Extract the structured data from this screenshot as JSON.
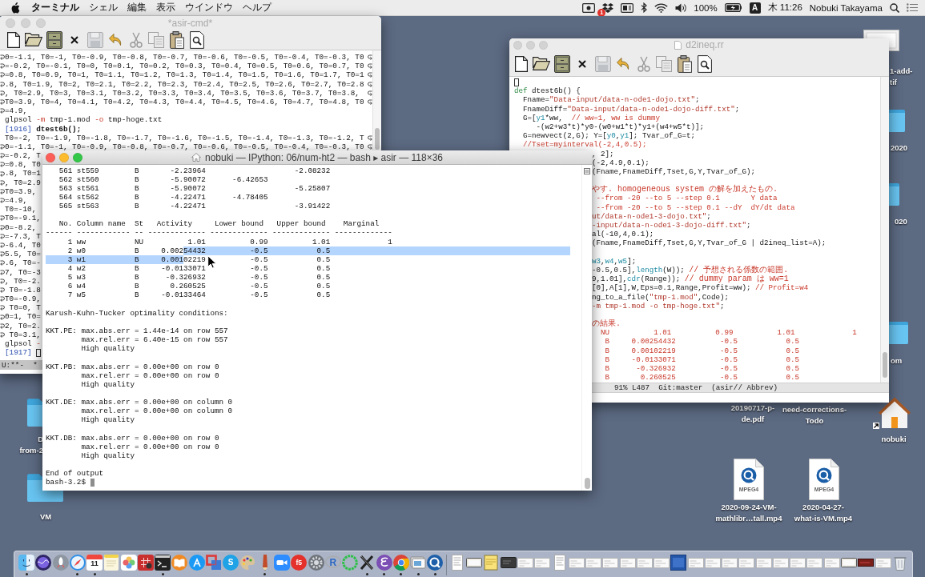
{
  "menu_bar": {
    "app_name": "ターミナル",
    "menus": [
      "シェル",
      "編集",
      "表示",
      "ウインドウ",
      "ヘルプ"
    ],
    "status_items": [
      {
        "kind": "screen_recording"
      },
      {
        "kind": "box_logo",
        "badge": "1"
      },
      {
        "kind": "panel"
      },
      {
        "kind": "bluetooth"
      },
      {
        "kind": "wifi"
      },
      {
        "kind": "volume"
      },
      {
        "kind": "battery_percent",
        "text": "100%"
      },
      {
        "kind": "battery"
      },
      {
        "kind": "input_source",
        "text": "A"
      },
      {
        "kind": "clock",
        "text": "木 11:26"
      },
      {
        "kind": "user",
        "text": "Nobuki Takayama"
      },
      {
        "kind": "search"
      },
      {
        "kind": "list"
      }
    ]
  },
  "desktop_icons": [
    {
      "kind": "picture",
      "label_lines": [
        "1-add-",
        "tif"
      ]
    },
    {
      "kind": "folder",
      "label_lines": [
        "2020"
      ]
    },
    {
      "kind": "folder",
      "label_lines": [
        "020"
      ]
    },
    {
      "kind": "folder",
      "label_lines": [
        "om"
      ]
    },
    {
      "kind": "folder",
      "label_lines": [
        "D",
        "from-2"
      ]
    },
    {
      "kind": "folder",
      "label_lines": [
        "VM"
      ]
    },
    {
      "kind": "covered",
      "label_lines": [
        "20190717-p-",
        "de.pdf"
      ]
    },
    {
      "kind": "covered",
      "label_lines": [
        "need-corrections-",
        "Todo"
      ]
    },
    {
      "kind": "home_alias",
      "label_lines": [
        "nobuki"
      ]
    },
    {
      "kind": "video",
      "badge": "MPEG4",
      "label_lines": [
        "2020-09-24-VM-",
        "mathlibr…tall.mp4"
      ]
    },
    {
      "kind": "video",
      "badge": "MPEG4",
      "label_lines": [
        "2020-04-27-",
        "what-is-VM.mp4"
      ]
    }
  ],
  "windows": [
    {
      "kind": "emacs",
      "title": "*asir-cmd*",
      "title_icon": false,
      "active": false,
      "toolbar": [
        {
          "kind": "new",
          "disabled": false
        },
        {
          "kind": "open",
          "disabled": false
        },
        {
          "kind": "dired",
          "disabled": false
        },
        {
          "kind": "close",
          "disabled": false
        },
        {
          "kind": "save",
          "disabled": true
        },
        {
          "kind": "undo",
          "disabled": false
        },
        {
          "kind": "cut",
          "disabled": true
        },
        {
          "kind": "copy",
          "disabled": true
        },
        {
          "kind": "paste",
          "disabled": false
        },
        {
          "kind": "search",
          "disabled": false
        }
      ],
      "lines": [
        {
          "wrap_in": true,
          "wrap_out": true,
          "cursor": false,
          "tokens": [
            {
              "text": "0=-1.1, T0=-1, T0=-0.9, T0=-0.8, T0=-0.7, T0=-0.6, T0=-0.5, T0=-0.4, T0=-0.3, T0",
              "kind": "plain"
            }
          ]
        },
        {
          "wrap_in": true,
          "wrap_out": true,
          "cursor": false,
          "tokens": [
            {
              "text": "=-0.2, T0=-0.1, T0=0, T0=0.1, T0=0.2, T0=0.3, T0=0.4, T0=0.5, T0=0.6, T0=0.7, T0",
              "kind": "plain"
            }
          ]
        },
        {
          "wrap_in": true,
          "wrap_out": true,
          "cursor": false,
          "tokens": [
            {
              "text": "=0.8, T0=0.9, T0=1, T0=1.1, T0=1.2, T0=1.3, T0=1.4, T0=1.5, T0=1.6, T0=1.7, T0=1",
              "kind": "plain"
            }
          ]
        },
        {
          "wrap_in": true,
          "wrap_out": true,
          "cursor": false,
          "tokens": [
            {
              "text": ".8, T0=1.9, T0=2, T0=2.1, T0=2.2, T0=2.3, T0=2.4, T0=2.5, T0=2.6, T0=2.7, T0=2.8",
              "kind": "plain"
            }
          ]
        },
        {
          "wrap_in": true,
          "wrap_out": true,
          "cursor": false,
          "tokens": [
            {
              "text": ", T0=2.9, T0=3, T0=3.1, T0=3.2, T0=3.3, T0=3.4, T0=3.5, T0=3.6, T0=3.7, T0=3.8,",
              "kind": "plain"
            }
          ]
        },
        {
          "wrap_in": true,
          "wrap_out": true,
          "cursor": false,
          "tokens": [
            {
              "text": "T0=3.9, T0=4, T0=4.1, T0=4.2, T0=4.3, T0=4.4, T0=4.5, T0=4.6, T0=4.7, T0=4.8, T0",
              "kind": "plain"
            }
          ]
        },
        {
          "wrap_in": true,
          "wrap_out": false,
          "cursor": false,
          "tokens": [
            {
              "text": "=4.9,",
              "kind": "plain"
            }
          ]
        },
        {
          "wrap_in": false,
          "wrap_out": false,
          "cursor": false,
          "tokens": [
            {
              "text": "glpsol ",
              "kind": "plain"
            },
            {
              "text": "-m",
              "kind": "flag"
            },
            {
              "text": " tmp-1.mod ",
              "kind": "plain"
            },
            {
              "text": "-o",
              "kind": "flag"
            },
            {
              "text": " tmp-hoge.txt",
              "kind": "plain"
            }
          ]
        },
        {
          "wrap_in": false,
          "wrap_out": false,
          "cursor": false,
          "tokens": [
            {
              "text": "[1916]",
              "kind": "prompt"
            },
            {
              "text": " dtest6b();",
              "kind": "bold"
            }
          ]
        },
        {
          "wrap_in": false,
          "wrap_out": true,
          "cursor": false,
          "tokens": [
            {
              "text": "T0=-2, T0=-1.9, T0=-1.8, T0=-1.7, T0=-1.6, T0=-1.5, T0=-1.4, T0=-1.3, T0=-1.2, T",
              "kind": "plain"
            }
          ]
        },
        {
          "wrap_in": true,
          "wrap_out": true,
          "cursor": false,
          "tokens": [
            {
              "text": "0=-1.1, T0=-1, T0=-0.9, T0=-0.8, T0=-0.7, T0=-0.6, T0=-0.5, T0=-0.4, T0=-0.3, T0",
              "kind": "plain"
            }
          ]
        },
        {
          "wrap_in": true,
          "wrap_out": false,
          "cursor": false,
          "tokens": [
            {
              "text": "=-0.2, T",
              "kind": "plain"
            }
          ]
        },
        {
          "wrap_in": true,
          "wrap_out": false,
          "cursor": false,
          "tokens": [
            {
              "text": "=0.8, T0",
              "kind": "plain"
            }
          ]
        },
        {
          "wrap_in": true,
          "wrap_out": false,
          "cursor": false,
          "tokens": [
            {
              "text": ".8, T0=1",
              "kind": "plain"
            }
          ]
        },
        {
          "wrap_in": true,
          "wrap_out": false,
          "cursor": false,
          "tokens": [
            {
              "text": ", T0=2.9",
              "kind": "plain"
            }
          ]
        },
        {
          "wrap_in": true,
          "wrap_out": false,
          "cursor": false,
          "tokens": [
            {
              "text": "T0=3.9,",
              "kind": "plain"
            }
          ]
        },
        {
          "wrap_in": true,
          "wrap_out": false,
          "cursor": false,
          "tokens": [
            {
              "text": "=4.9,",
              "kind": "plain"
            }
          ]
        },
        {
          "wrap_in": false,
          "wrap_out": false,
          "cursor": false,
          "tokens": [
            {
              "text": "T0=-10,",
              "kind": "plain"
            }
          ]
        },
        {
          "wrap_in": true,
          "wrap_out": false,
          "cursor": false,
          "tokens": [
            {
              "text": "T0=-9.1,",
              "kind": "plain"
            }
          ]
        },
        {
          "wrap_in": true,
          "wrap_out": false,
          "cursor": false,
          "tokens": [
            {
              "text": "0=-8.2,",
              "kind": "plain"
            }
          ]
        },
        {
          "wrap_in": true,
          "wrap_out": false,
          "cursor": false,
          "tokens": [
            {
              "text": "=-7.3, T",
              "kind": "plain"
            }
          ]
        },
        {
          "wrap_in": true,
          "wrap_out": false,
          "cursor": false,
          "tokens": [
            {
              "text": "-6.4, T0",
              "kind": "plain"
            }
          ]
        },
        {
          "wrap_in": true,
          "wrap_out": false,
          "cursor": false,
          "tokens": [
            {
              "text": "5.5, T0=",
              "kind": "plain"
            }
          ]
        },
        {
          "wrap_in": true,
          "wrap_out": false,
          "cursor": false,
          "tokens": [
            {
              "text": ".6, T0=-",
              "kind": "plain"
            }
          ]
        },
        {
          "wrap_in": true,
          "wrap_out": false,
          "cursor": false,
          "tokens": [
            {
              "text": "7, T0=-3",
              "kind": "plain"
            }
          ]
        },
        {
          "wrap_in": true,
          "wrap_out": false,
          "cursor": false,
          "tokens": [
            {
              "text": ", T0=-2.",
              "kind": "plain"
            }
          ]
        },
        {
          "wrap_in": true,
          "wrap_out": false,
          "cursor": false,
          "tokens": [
            {
              "text": " T0=-1.8",
              "kind": "plain"
            }
          ]
        },
        {
          "wrap_in": true,
          "wrap_out": false,
          "cursor": false,
          "tokens": [
            {
              "text": "T0=-0.9,",
              "kind": "plain"
            }
          ]
        },
        {
          "wrap_in": true,
          "wrap_out": false,
          "cursor": false,
          "tokens": [
            {
              "text": " T0=0, T",
              "kind": "plain"
            }
          ]
        },
        {
          "wrap_in": true,
          "wrap_out": false,
          "cursor": false,
          "tokens": [
            {
              "text": "0=1, T0=",
              "kind": "plain"
            }
          ]
        },
        {
          "wrap_in": true,
          "wrap_out": false,
          "cursor": false,
          "tokens": [
            {
              "text": "2, T0=2.",
              "kind": "plain"
            }
          ]
        },
        {
          "wrap_in": true,
          "wrap_out": false,
          "cursor": false,
          "tokens": [
            {
              "text": " T0=3.1,",
              "kind": "plain"
            }
          ]
        },
        {
          "wrap_in": false,
          "wrap_out": false,
          "cursor": false,
          "tokens": [
            {
              "text": "glpsol ",
              "kind": "plain"
            },
            {
              "text": "-",
              "kind": "flag"
            }
          ]
        },
        {
          "wrap_in": false,
          "wrap_out": false,
          "cursor": true,
          "tokens": [
            {
              "text": "[1917] ",
              "kind": "prompt"
            }
          ]
        }
      ],
      "mode_line": "U:**-  *"
    },
    {
      "kind": "emacs",
      "title": "d2ineq.rr",
      "title_icon": true,
      "active": false,
      "toolbar": [
        {
          "kind": "new",
          "disabled": false
        },
        {
          "kind": "open",
          "disabled": false
        },
        {
          "kind": "dired",
          "disabled": false
        },
        {
          "kind": "close",
          "disabled": false
        },
        {
          "kind": "save",
          "disabled": true
        },
        {
          "kind": "undo",
          "disabled": false
        },
        {
          "kind": "cut",
          "disabled": true
        },
        {
          "kind": "copy",
          "disabled": true
        },
        {
          "kind": "paste",
          "disabled": false
        },
        {
          "kind": "search",
          "disabled": false
        }
      ],
      "lines": [
        {
          "cursor": true
        },
        {
          "cursor": false,
          "tokens": [
            {
              "text": "def",
              "kind": "keyword"
            },
            {
              "text": " dtest6b() {",
              "kind": "plain"
            }
          ]
        },
        {
          "cursor": false,
          "tokens": [
            {
              "text": "  Fname=",
              "kind": "plain"
            },
            {
              "text": "\"Data-input/data-n-ode1-dojo.txt\"",
              "kind": "string"
            },
            {
              "text": ";",
              "kind": "plain"
            }
          ]
        },
        {
          "cursor": false,
          "tokens": [
            {
              "text": "  FnameDiff=",
              "kind": "plain"
            },
            {
              "text": "\"Data-input/data-n-ode1-dojo-diff.txt\"",
              "kind": "string"
            },
            {
              "text": ";",
              "kind": "plain"
            }
          ]
        },
        {
          "cursor": false,
          "tokens": [
            {
              "text": "  G=[",
              "kind": "plain"
            },
            {
              "text": "y1",
              "kind": "variable"
            },
            {
              "text": "*ww,  ",
              "kind": "plain"
            },
            {
              "text": "// ww=1, ww is dummy",
              "kind": "comment"
            }
          ]
        },
        {
          "cursor": false,
          "tokens": [
            {
              "text": "     -(w2+w3*t)*y0-(w0+w1*t)*y1+(w4+w5*t)];",
              "kind": "plain"
            }
          ]
        },
        {
          "cursor": false,
          "tokens": [
            {
              "text": "  G=newvect(2,G); Y=[",
              "kind": "plain"
            },
            {
              "text": "y0",
              "kind": "variable"
            },
            {
              "text": ",",
              "kind": "plain"
            },
            {
              "text": "y1",
              "kind": "variable"
            },
            {
              "text": "]; Tvar_of_G=t;",
              "kind": "plain"
            }
          ]
        },
        {
          "cursor": false,
          "tokens": [
            {
              "text": "  //Tset=myinterval(-2,4,0.5);",
              "kind": "comment"
            }
          ]
        }
      ],
      "partly_hidden_lines": [
        {
          "cursor": false,
          "tokens": [
            {
              "text": ", 2];",
              "kind": "plain"
            }
          ]
        },
        {
          "cursor": false,
          "tokens": [
            {
              "text": "(-2,4.9,0.1);",
              "kind": "plain"
            }
          ]
        },
        {
          "cursor": false,
          "tokens": [
            {
              "text": "(Fname,FnameDiff,Tset,G,Y,Tvar_of_G);",
              "kind": "plain"
            }
          ]
        },
        {
          "cursor": false
        },
        {
          "cursor": false,
          "tokens": [
            {
              "text": "やす. homogeneous system の解を加えたもの.",
              "kind": "comment"
            }
          ]
        },
        {
          "cursor": false,
          "tokens": [
            {
              "text": " --from -20 --to 5 --step 0.1       Y data",
              "kind": "comment"
            }
          ]
        },
        {
          "cursor": false,
          "tokens": [
            {
              "text": " --from -20 --to 5 --step 0.1 --dY  dY/dt data",
              "kind": "comment"
            }
          ]
        },
        {
          "cursor": false,
          "tokens": [
            {
              "text": "ut/data-n-ode1-3-dojo.txt\"",
              "kind": "string"
            },
            {
              "text": ";",
              "kind": "plain"
            }
          ]
        },
        {
          "cursor": false,
          "tokens": [
            {
              "text": "-input/data-n-ode1-3-dojo-diff.txt\"",
              "kind": "string"
            },
            {
              "text": ";",
              "kind": "plain"
            }
          ]
        },
        {
          "cursor": false,
          "tokens": [
            {
              "text": "al(-10,4,0.1);",
              "kind": "plain"
            }
          ]
        },
        {
          "cursor": false,
          "tokens": [
            {
              "text": "(Fname,FnameDiff,Tset,G,Y,Tvar_of_G | d2ineq_list=A);",
              "kind": "plain"
            }
          ]
        },
        {
          "cursor": false
        },
        {
          "cursor": false,
          "tokens": [
            {
              "text": "w3",
              "kind": "variable"
            },
            {
              "text": ",",
              "kind": "plain"
            },
            {
              "text": "w4",
              "kind": "variable"
            },
            {
              "text": ",",
              "kind": "plain"
            },
            {
              "text": "w5",
              "kind": "variable"
            },
            {
              "text": "];",
              "kind": "plain"
            }
          ]
        },
        {
          "cursor": false,
          "tokens": [
            {
              "text": "-0.5,0.5],",
              "kind": "plain"
            },
            {
              "text": "length",
              "kind": "variable"
            },
            {
              "text": "(W)); ",
              "kind": "plain"
            },
            {
              "text": "// 予想される係数の範囲.",
              "kind": "comment"
            }
          ]
        },
        {
          "cursor": false,
          "tokens": [
            {
              "text": "9,1.01],",
              "kind": "plain"
            },
            {
              "text": "cdr",
              "kind": "variable"
            },
            {
              "text": "(Range)); ",
              "kind": "plain"
            },
            {
              "text": "// dummy param は ww=1",
              "kind": "comment"
            }
          ]
        },
        {
          "cursor": false,
          "tokens": [
            {
              "text": "[0],A[1],W,Eps=0.1,Range,Profit=ww); ",
              "kind": "plain"
            },
            {
              "text": "// Profit=w4",
              "kind": "comment"
            }
          ]
        },
        {
          "cursor": false,
          "tokens": [
            {
              "text": "ng_to_a_file(",
              "kind": "plain"
            },
            {
              "text": "\"tmp-1.mod\"",
              "kind": "string"
            },
            {
              "text": ",Code);",
              "kind": "plain"
            }
          ]
        },
        {
          "cursor": false,
          "tokens": [
            {
              "text": "-m tmp-1.mod -o tmp-hoge.txt\"",
              "kind": "string"
            },
            {
              "text": ";",
              "kind": "plain"
            }
          ]
        },
        {
          "cursor": false
        },
        {
          "cursor": false,
          "tokens": [
            {
              "text": "の結果.",
              "kind": "comment"
            }
          ]
        },
        {
          "cursor": false,
          "tokens": [
            {
              "text": "  NU          1.01          0.99          1.01             1",
              "kind": "comment"
            }
          ]
        },
        {
          "cursor": false,
          "tokens": [
            {
              "text": "   B     0.00254432          -0.5           0.5",
              "kind": "comment"
            }
          ]
        },
        {
          "cursor": false,
          "tokens": [
            {
              "text": "   B     0.00102219          -0.5           0.5",
              "kind": "comment"
            }
          ]
        },
        {
          "cursor": false,
          "tokens": [
            {
              "text": "   B     -0.0133071          -0.5           0.5",
              "kind": "comment"
            }
          ]
        },
        {
          "cursor": false,
          "tokens": [
            {
              "text": "   B      -0.326932          -0.5           0.5",
              "kind": "comment"
            }
          ]
        },
        {
          "cursor": false,
          "tokens": [
            {
              "text": "   B       0.260525          -0.5           0.5",
              "kind": "comment"
            }
          ]
        }
      ],
      "mode_line": "91% L487  Git:master  (asir// Abbrev)"
    },
    {
      "kind": "terminal",
      "title": "nobuki — IPython: 06/num-ht2 — bash ▸ asir — 118×36",
      "title_icon": true,
      "active": true,
      "rows_listing": [
        {
          "no": "561",
          "name": "st559",
          "st": "B",
          "activity": "-2.23964",
          "upper": "-2.08232"
        },
        {
          "no": "562",
          "name": "st560",
          "st": "B",
          "activity": "-5.90072",
          "lower": "-6.42653"
        },
        {
          "no": "563",
          "name": "st561",
          "st": "B",
          "activity": "-5.90072",
          "upper": "-5.25807"
        },
        {
          "no": "564",
          "name": "st562",
          "st": "B",
          "activity": "-4.22471",
          "lower": "-4.78405"
        },
        {
          "no": "565",
          "name": "st563",
          "st": "B",
          "activity": "-4.22471",
          "upper": "-3.91422"
        }
      ],
      "columns_table": {
        "columns": [
          "No.",
          "Column name",
          "St",
          "Activity",
          "Lower bound",
          "Upper bound",
          "Marginal"
        ],
        "rules": [
          "------",
          "------------",
          "--",
          "-------------",
          "-------------",
          "-------------",
          "-------------"
        ],
        "rows": [
          {
            "no": "1",
            "name": "ww",
            "st": "NU",
            "activity": "1.01",
            "lower": "0.99",
            "upper": "1.01",
            "marginal": "1",
            "selection_start": false,
            "selection_end": false
          },
          {
            "no": "2",
            "name": "w0",
            "st": "B",
            "activity": "0.00254432",
            "lower": "-0.5",
            "upper": "0.5",
            "selection_start": true,
            "selection_end": false
          },
          {
            "no": "3",
            "name": "w1",
            "st": "B",
            "activity": "0.00102219",
            "lower": "-0.5",
            "upper": "0.5",
            "selection_start": false,
            "selection_end": true
          },
          {
            "no": "4",
            "name": "w2",
            "st": "B",
            "activity": "-0.0133071",
            "lower": "-0.5",
            "upper": "0.5",
            "selection_start": false,
            "selection_end": false
          },
          {
            "no": "5",
            "name": "w3",
            "st": "B",
            "activity": "-0.326932",
            "lower": "-0.5",
            "upper": "0.5",
            "selection_start": false,
            "selection_end": false
          },
          {
            "no": "6",
            "name": "w4",
            "st": "B",
            "activity": "0.260525",
            "lower": "-0.5",
            "upper": "0.5",
            "selection_start": false,
            "selection_end": false
          },
          {
            "no": "7",
            "name": "w5",
            "st": "B",
            "activity": "-0.0133464",
            "lower": "-0.5",
            "upper": "0.5",
            "selection_start": false,
            "selection_end": false
          }
        ]
      },
      "kkt_title": "Karush-Kuhn-Tucker optimality conditions:",
      "kkt": [
        {
          "label": "KKT.PE:",
          "lines": [
            "max.abs.err = 1.44e-14 on row 557",
            "max.rel.err = 6.40e-15 on row 557",
            "High quality"
          ]
        },
        {
          "label": "KKT.PB:",
          "lines": [
            "max.abs.err = 0.00e+00 on row 0",
            "max.rel.err = 0.00e+00 on row 0",
            "High quality"
          ]
        },
        {
          "label": "KKT.DE:",
          "lines": [
            "max.abs.err = 0.00e+00 on column 0",
            "max.rel.err = 0.00e+00 on column 0",
            "High quality"
          ]
        },
        {
          "label": "KKT.DB:",
          "lines": [
            "max.abs.err = 0.00e+00 on row 0",
            "max.rel.err = 0.00e+00 on row 0",
            "High quality"
          ]
        }
      ],
      "end_text": "End of output",
      "prompt": "bash-3.2$"
    }
  ],
  "dock": {
    "apps": [
      {
        "kind": "finder",
        "running": true
      },
      {
        "kind": "siri",
        "running": false
      },
      {
        "kind": "launchpad",
        "running": false
      },
      {
        "kind": "safari",
        "running": true
      },
      {
        "kind": "calendar",
        "glyph": "11",
        "running": true
      },
      {
        "kind": "notes",
        "running": false
      },
      {
        "kind": "photos",
        "running": false
      },
      {
        "kind": "grid",
        "running": false
      },
      {
        "kind": "terminal",
        "running": true
      },
      {
        "kind": "books",
        "running": false
      },
      {
        "kind": "store",
        "running": false
      },
      {
        "kind": "squares",
        "running": false
      },
      {
        "kind": "chat",
        "glyph": "S",
        "running": false
      },
      {
        "kind": "palette",
        "running": false
      },
      {
        "kind": "pencil",
        "running": true
      },
      {
        "kind": "camera",
        "running": false
      },
      {
        "kind": "circle_logo",
        "glyph": "f5",
        "running": false
      },
      {
        "kind": "settings",
        "running": false
      },
      {
        "kind": "ring_logo",
        "glyph": "R",
        "running": false
      },
      {
        "kind": "ring",
        "running": false
      },
      {
        "kind": "x_logo",
        "running": true
      },
      {
        "kind": "swirl",
        "running": true
      },
      {
        "kind": "tricolor",
        "running": true
      },
      {
        "kind": "viewer",
        "running": true
      },
      {
        "kind": "q_logo",
        "running": true
      }
    ],
    "stack": [
      {
        "kind": "page"
      },
      {
        "kind": "window"
      },
      {
        "kind": "note"
      },
      {
        "kind": "dark_window"
      },
      {
        "kind": "screenshot"
      },
      {
        "kind": "screenshot"
      },
      {
        "kind": "page"
      },
      {
        "kind": "screenshot"
      },
      {
        "kind": "screenshot"
      },
      {
        "kind": "screenshot"
      },
      {
        "kind": "screenshot"
      },
      {
        "kind": "screenshot"
      },
      {
        "kind": "screenshot"
      },
      {
        "kind": "blue_window"
      },
      {
        "kind": "screenshot"
      },
      {
        "kind": "screenshot"
      },
      {
        "kind": "screenshot"
      },
      {
        "kind": "screenshot"
      },
      {
        "kind": "screenshot"
      },
      {
        "kind": "screenshot"
      },
      {
        "kind": "screenshot"
      },
      {
        "kind": "screenshot"
      },
      {
        "kind": "screenshot"
      },
      {
        "kind": "window"
      },
      {
        "kind": "red_window"
      },
      {
        "kind": "screenshot"
      },
      {
        "kind": "trash"
      }
    ]
  }
}
